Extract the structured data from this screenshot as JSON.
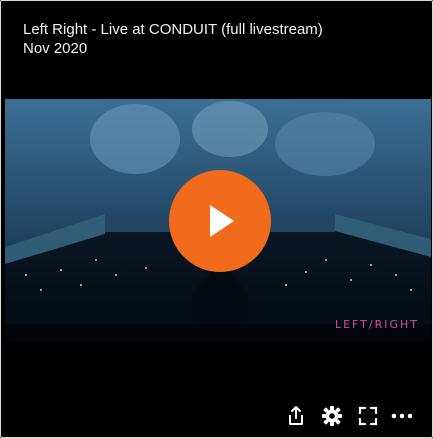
{
  "video": {
    "title": "Left Right - Live at CONDUIT (full livestream)",
    "date": "Nov 2020",
    "brand_text": "LEFT/RIGHT",
    "accent_color": "#f26b1d"
  },
  "controls": {
    "share": "share-icon",
    "settings": "gear-icon",
    "fullscreen": "fullscreen-icon",
    "more": "more-icon"
  }
}
